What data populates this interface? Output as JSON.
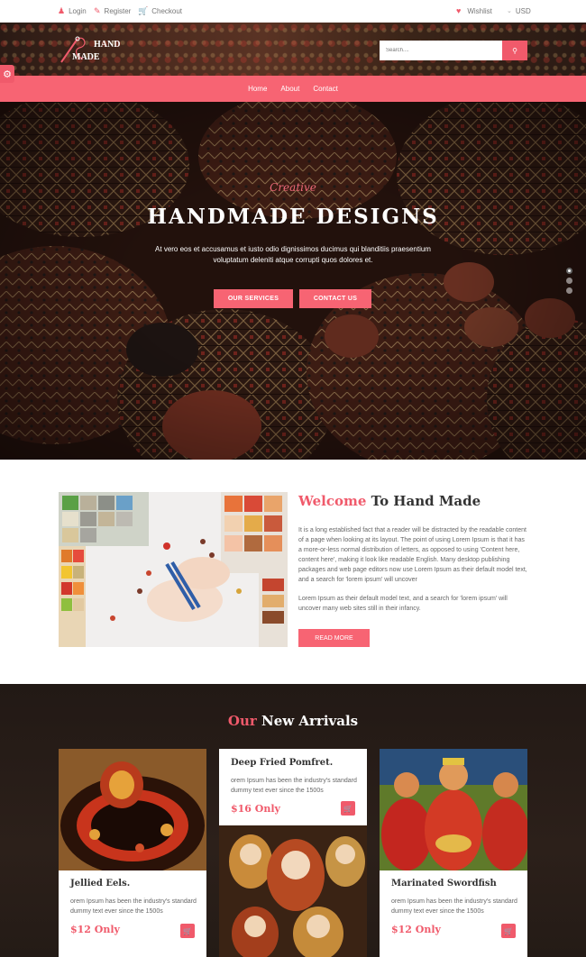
{
  "topbar": {
    "login": "Login",
    "register": "Register",
    "checkout": "Checkout",
    "wishlist": "Wishlist",
    "currency": "USD"
  },
  "logo": {
    "line1": "HAND",
    "line2": "MADE"
  },
  "search": {
    "placeholder": "Search...."
  },
  "nav": {
    "items": [
      "Home",
      "About",
      "Contact"
    ]
  },
  "hero": {
    "script": "Creative",
    "title": "HANDMADE DESIGNS",
    "subtitle": "At vero eos et accusamus et iusto odio dignissimos ducimus qui blanditiis praesentium voluptatum deleniti atque corrupti quos dolores et.",
    "btn_services": "OUR SERVICES",
    "btn_contact": "CONTACT US"
  },
  "welcome": {
    "title_accent": "Welcome",
    "title_rest": " To Hand Made",
    "para1": "It is a long established fact that a reader will be distracted by the readable content of a page when looking at its layout. The point of using Lorem Ipsum is that it has a more-or-less normal distribution of letters, as opposed to using 'Content here, content here', making it look like readable English. Many desktop publishing packages and web page editors now use Lorem Ipsum as their default model text, and a search for 'lorem ipsum' will uncover",
    "para2": "Lorem Ipsum as their default model text, and a search for 'lorem ipsum' will uncover many web sites still in their infancy.",
    "read_more": "READ MORE"
  },
  "arrivals": {
    "title_accent": "Our",
    "title_rest": " New Arrivals",
    "cards": [
      {
        "name": "Jellied Eels.",
        "desc": "orem Ipsum has been the industry's standard dummy text ever since the 1500s",
        "price": "$12 Only"
      },
      {
        "name": "Deep Fried Pomfret.",
        "desc": "orem Ipsum has been the industry's standard dummy text ever since the 1500s",
        "price": "$16 Only"
      },
      {
        "name": "Marinated Swordfish",
        "desc": "orem Ipsum has been the industry's standard dummy text ever since the 1500s",
        "price": "$12 Only"
      }
    ]
  },
  "colors": {
    "accent": "#f76473",
    "accent_text": "#f05a6b",
    "dark_section": "#2a1e18"
  },
  "icons": [
    "user-icon",
    "pencil-icon",
    "cart-icon",
    "heart-icon",
    "chevron-down-icon",
    "search-icon",
    "gear-icon"
  ]
}
